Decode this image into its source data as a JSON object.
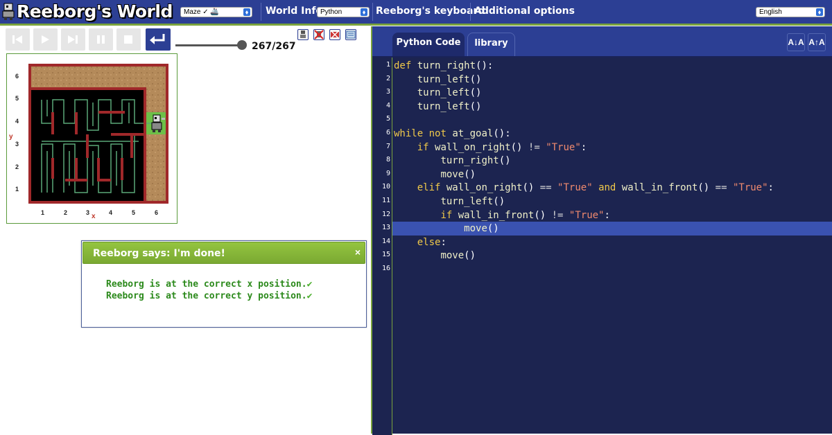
{
  "header": {
    "title": "Reeborg's World",
    "world_select": "Maze ✓ 🚢",
    "world_info": "World Info",
    "language_select": "Python",
    "keyboard": "Reeborg's keyboard",
    "additional_options": "Additional options",
    "ui_language": "English"
  },
  "controls": {
    "step_counter": "267/267",
    "slider_fraction": 1.0
  },
  "world": {
    "x_axis_label": "x",
    "y_axis_label": "y",
    "x_ticks": [
      "1",
      "2",
      "3",
      "4",
      "5",
      "6"
    ],
    "y_ticks": [
      "1",
      "2",
      "3",
      "4",
      "5",
      "6"
    ],
    "robot_position": {
      "x": 6,
      "y": 4
    },
    "goal_position": {
      "x": 6,
      "y": 4
    },
    "colors": {
      "wall": "#a0282a",
      "maze_floor": "#000000",
      "sand": "#b48a5a",
      "goal": "#6dc048",
      "path_trace": "#5aa878"
    }
  },
  "dialog": {
    "title": "Reeborg says: I'm done!",
    "close": "×",
    "line1": "Reeborg is at the correct x position.",
    "line2": "Reeborg is at the correct y position.",
    "check": "✔"
  },
  "editor": {
    "tabs": [
      "Python Code",
      "library"
    ],
    "font_decrease": "A↓A",
    "font_increase": "A↑A",
    "highlighted_line": 13,
    "line_numbers": [
      "1",
      "2",
      "3",
      "4",
      "5",
      "6",
      "7",
      "8",
      "9",
      "10",
      "11",
      "12",
      "13",
      "14",
      "15",
      "16"
    ],
    "code": [
      "def turn_right():",
      "    turn_left()",
      "    turn_left()",
      "    turn_left()",
      "",
      "while not at_goal():",
      "    if wall_on_right() != \"True\":",
      "        turn_right()",
      "        move()",
      "    elif wall_on_right() == \"True\" and wall_in_front() == \"True\":",
      "        turn_left()",
      "        if wall_in_front() != \"True\":",
      "            move()",
      "    else:",
      "        move()",
      ""
    ]
  }
}
